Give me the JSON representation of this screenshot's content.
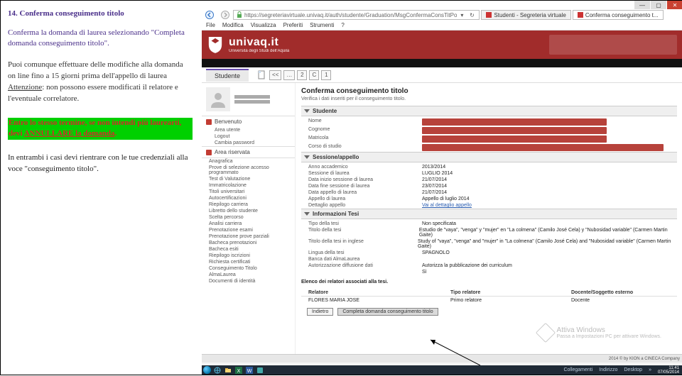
{
  "doc": {
    "title": "14. Conferma conseguimento titolo",
    "lead": "Conferma la domanda di laurea selezionando \"Completa domanda conseguimento titolo\".",
    "para1_a": "Puoi comunque effettuare delle modifiche alla domanda on line fino a 15 giorni prima dell'appello di laurea",
    "para1_b_under": "Attenzione",
    "para1_c": ": non possono essere modificati il relatore e l'eventuale correlatore.",
    "hl_a": "Entro lo stesso termine, se non intendi più laurearti, devi ",
    "hl_b_under": "ANNULLARE la domanda",
    "hl_c": ".",
    "para3": "In entrambi i casi devi rientrare con le tue credenziali alla voce \"conseguimento titolo\"."
  },
  "window": {
    "min": "—",
    "max": "▢",
    "close": "✕"
  },
  "url": "https://segreteriavirtuale.univaq.it/auth/studente/Graduation/MsgConfermaConsTitPo",
  "url_actions": {
    "refresh": "↻",
    "lock": "🔒"
  },
  "tabs": {
    "t1": "Studenti - Segreteria virtuale",
    "t2": "Conferma conseguimento t..."
  },
  "ie_menu": {
    "m1": "File",
    "m2": "Modifica",
    "m3": "Visualizza",
    "m4": "Preferiti",
    "m5": "Strumenti",
    "m6": "?"
  },
  "brand": {
    "name": "univaq.it",
    "sub": "Università degli Studi dell'Aquila"
  },
  "stutab": "Studente",
  "pager": {
    "back": "<<",
    "p2": "2",
    "pC": "C",
    "p1": "1"
  },
  "leftmenu1": {
    "hdr": "Benvenuto",
    "i1": "Area utente",
    "i2": "Logout",
    "i3": "Cambia password"
  },
  "leftmenu2": {
    "hdr": "Area riservata",
    "items": [
      "Anagrafica",
      "Prove di selezione accesso programmato",
      "Test di Valutazione",
      "Immatricolazione",
      "Titoli universitari",
      "Autocertificazioni",
      "Riepilogo carriera",
      "Libretto dello studente",
      "Scelta percorso",
      "Analisi carriera",
      "Prenotazione esami",
      "Prenotazione prove parziali",
      "Bacheca prenotazioni",
      "Bacheca esiti",
      "Riepilogo iscrizioni",
      "Richiesta certificati",
      "Conseguimento Titolo",
      "AlmaLaurea",
      "Documenti di identità"
    ]
  },
  "content": {
    "title": "Conferma conseguimento titolo",
    "sub": "Verifica i dati inseriti per il conseguimento titolo.",
    "sec_stud": "Studente",
    "stud": {
      "k1": "Nome",
      "k2": "Cognome",
      "k3": "Matricola",
      "k4": "Corso di studio"
    },
    "sec_sess": "Sessione/appello",
    "sess": {
      "rows": [
        {
          "k": "Anno accademico",
          "v": "2013/2014"
        },
        {
          "k": "Sessione di laurea",
          "v": "LUGLIO 2014"
        },
        {
          "k": "Data inizio sessione di laurea",
          "v": "21/07/2014"
        },
        {
          "k": "Data fine sessione di laurea",
          "v": "23/07/2014"
        },
        {
          "k": "Data appello di laurea",
          "v": "21/07/2014"
        },
        {
          "k": "Appello di laurea",
          "v": "Appello di luglio 2014"
        }
      ],
      "detlink_k": "Dettaglio appello",
      "detlink_v": "Vai al dettaglio appello"
    },
    "sec_tesi": "Informazioni Tesi",
    "tesi": {
      "rows": [
        {
          "k": "Tipo della tesi",
          "v": "Non specificata"
        },
        {
          "k": "Titolo della tesi",
          "v": "Estudio de \"vaya\", \"venga\" y \"mujer\" en \"La colmena\" (Camilo José Cela) y \"Nubosidad variable\" (Carmen Martin Gaite)"
        },
        {
          "k": "Titolo della tesi in inglese",
          "v": "Study of \"vaya\", \"venga\" and \"mujer\" in \"La colmena\" (Camilo José Cela) and \"Nubosidad variable\" (Carmen Martin Gaite)"
        },
        {
          "k": "Lingua della tesi",
          "v": "SPAGNOLO"
        },
        {
          "k": "Banca dati AlmaLaurea",
          "v": ""
        },
        {
          "k": "Autorizzazione diffusione dati",
          "v": "Autorizza la pubblicazione dei curriculum"
        }
      ],
      "last_k": "",
      "last_v": "Sì"
    },
    "tbl_caption": "Elenco dei relatori associati alla tesi.",
    "tbl": {
      "h1": "Relatore",
      "h2": "Tipo relatore",
      "h3": "Docente/Soggetto esterno",
      "r1c1": "FLORES MARIA JOSE",
      "r1c2": "Primo relatore",
      "r1c3": "Docente"
    },
    "btn_back": "Indietro",
    "btn_go": "Completa domanda conseguimento titolo"
  },
  "footer": "2014 © by KION a CINECA Company",
  "watermark": {
    "t1": "Attiva Windows",
    "t2": "Passa a Impostazioni PC per attivare Windows."
  },
  "tray": {
    "t1": "Collegamenti",
    "t2": "Indirizzo",
    "t3": "Desktop",
    "time": "11:41",
    "date": "07/05/2014"
  }
}
